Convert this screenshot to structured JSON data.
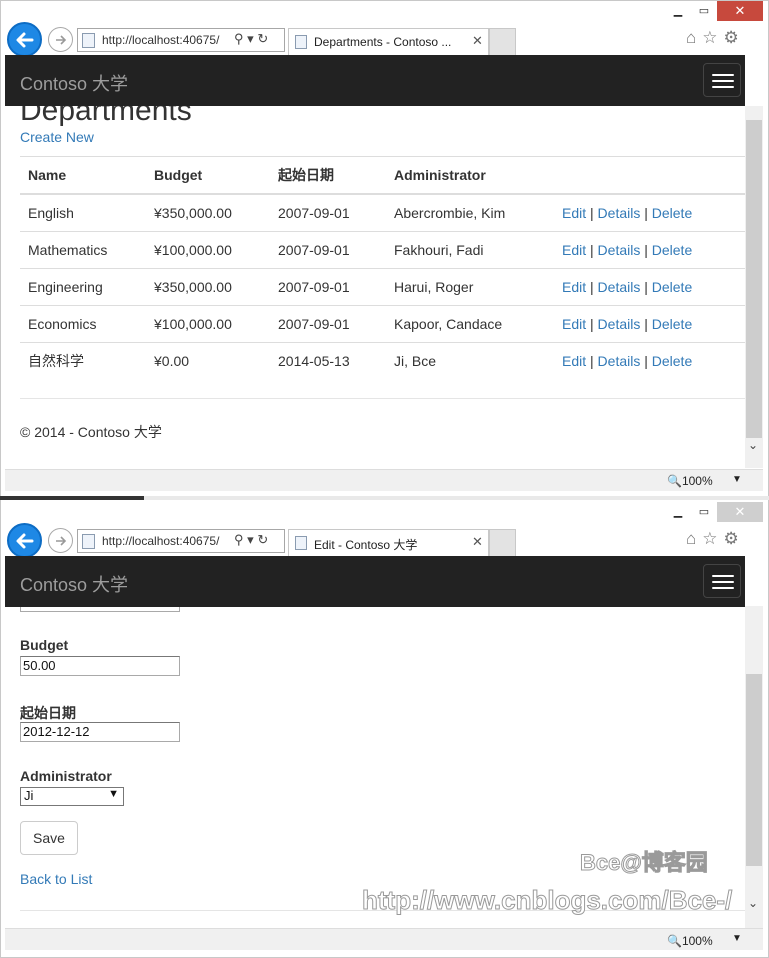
{
  "window1": {
    "url": "http://localhost:40675/",
    "tab_title": "Departments - Contoso ...",
    "brand": "Contoso 大学",
    "page_heading": "Departments",
    "create_new": "Create New",
    "columns": [
      "Name",
      "Budget",
      "起始日期",
      "Administrator"
    ],
    "rows": [
      {
        "name": "English",
        "budget": "¥350,000.00",
        "start": "2007-09-01",
        "admin": "Abercrombie, Kim"
      },
      {
        "name": "Mathematics",
        "budget": "¥100,000.00",
        "start": "2007-09-01",
        "admin": "Fakhouri, Fadi"
      },
      {
        "name": "Engineering",
        "budget": "¥350,000.00",
        "start": "2007-09-01",
        "admin": "Harui, Roger"
      },
      {
        "name": "Economics",
        "budget": "¥100,000.00",
        "start": "2007-09-01",
        "admin": "Kapoor, Candace"
      },
      {
        "name": "自然科学",
        "budget": "¥0.00",
        "start": "2014-05-13",
        "admin": "Ji, Bce"
      }
    ],
    "row_actions": {
      "edit": "Edit",
      "details": "Details",
      "delete": "Delete",
      "sep": "|"
    },
    "footer": "© 2014 - Contoso 大学",
    "zoom": "100%"
  },
  "window2": {
    "url": "http://localhost:40675/",
    "tab_title": "Edit - Contoso 大学",
    "brand": "Contoso 大学",
    "budget_label": "Budget",
    "budget_value": "50.00",
    "start_label": "起始日期",
    "start_value": "2012-12-12",
    "admin_label": "Administrator",
    "admin_value": "Ji",
    "save_label": "Save",
    "back_label": "Back to List",
    "zoom": "100%"
  },
  "watermark": {
    "line1": "Bce@博客园",
    "line2": "http://www.cnblogs.com/Bce-/"
  },
  "colors": {
    "navbar": "#222222",
    "link": "#337ab7",
    "back_button": "#1e88e5",
    "close_button": "#c7493d"
  }
}
